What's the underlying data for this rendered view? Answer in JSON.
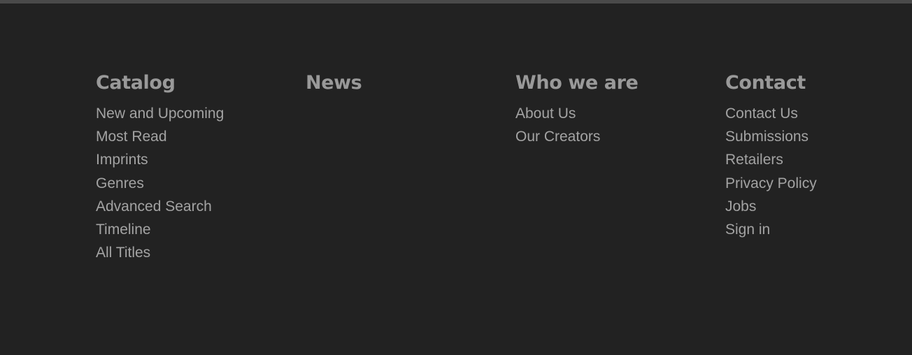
{
  "footer": {
    "catalog": {
      "heading": "Catalog",
      "links": [
        "New and Upcoming",
        "Most Read",
        "Imprints",
        "Genres",
        "Advanced Search",
        "Timeline",
        "All Titles"
      ]
    },
    "news": {
      "heading": "News",
      "links": []
    },
    "who_we_are": {
      "heading": "Who we are",
      "links": [
        "About Us",
        "Our Creators"
      ]
    },
    "contact": {
      "heading": "Contact",
      "links": [
        "Contact Us",
        "Submissions",
        "Retailers",
        "Privacy Policy",
        "Jobs",
        "Sign in"
      ]
    }
  },
  "colors": {
    "background": "#222222",
    "top_bar": "#4a4a4a",
    "heading": "#999999",
    "link": "#a3a3a3"
  }
}
